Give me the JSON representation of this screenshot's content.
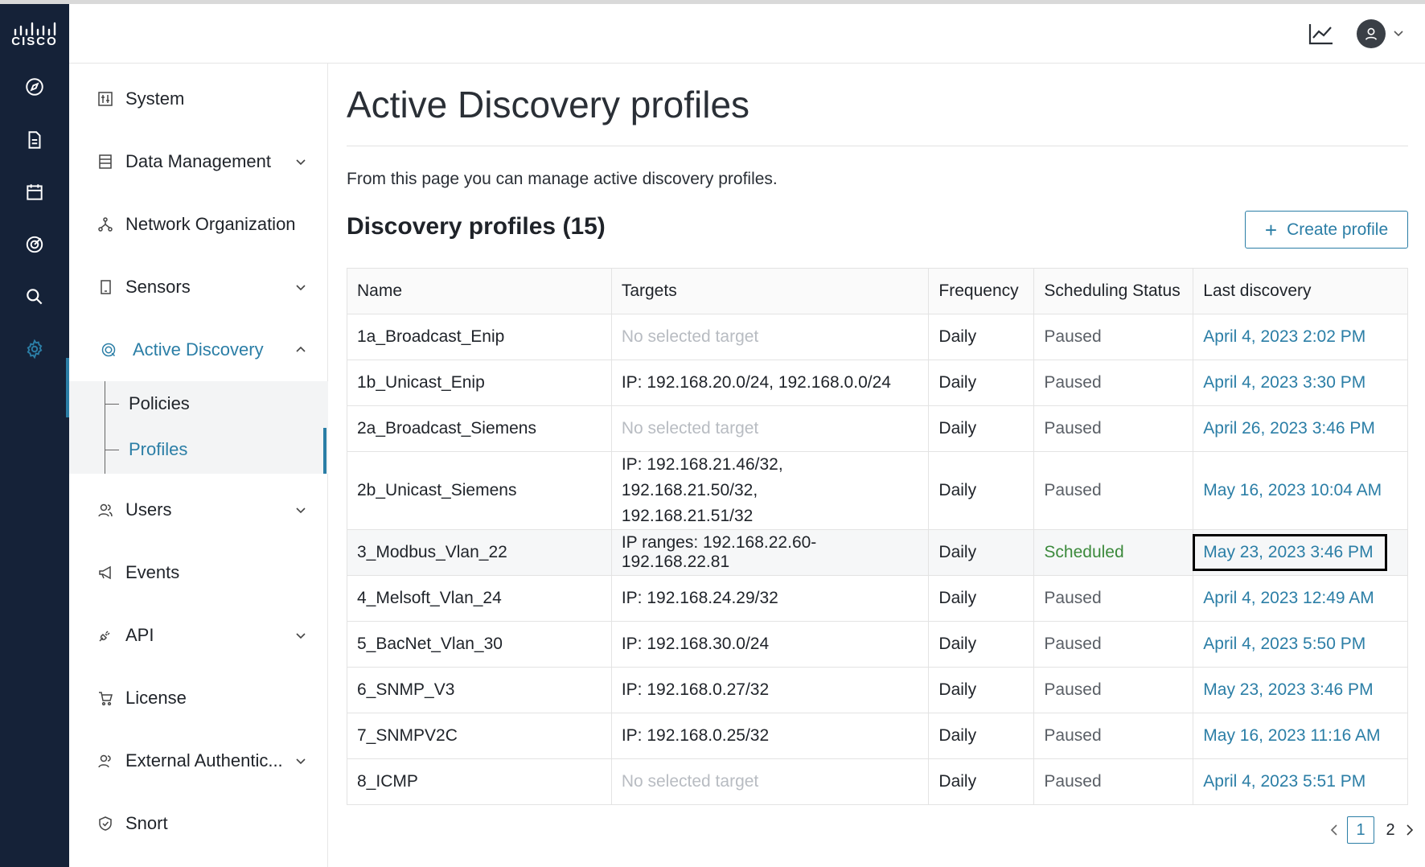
{
  "brand": {
    "logo_text": "CISCO"
  },
  "sidebar": {
    "items": [
      {
        "label": "System"
      },
      {
        "label": "Data Management"
      },
      {
        "label": "Network Organization"
      },
      {
        "label": "Sensors"
      },
      {
        "label": "Active Discovery"
      },
      {
        "label": "Users"
      },
      {
        "label": "Events"
      },
      {
        "label": "API"
      },
      {
        "label": "License"
      },
      {
        "label": "External Authentic..."
      },
      {
        "label": "Snort"
      }
    ],
    "subitems": [
      {
        "label": "Policies"
      },
      {
        "label": "Profiles"
      }
    ]
  },
  "page": {
    "title": "Active Discovery profiles",
    "description": "From this page you can manage active discovery profiles.",
    "section_title": "Discovery profiles (15)",
    "create_label": "Create profile"
  },
  "table": {
    "headers": [
      "Name",
      "Targets",
      "Frequency",
      "Scheduling Status",
      "Last discovery"
    ],
    "rows": [
      {
        "name": "1a_Broadcast_Enip",
        "targets": "No selected target",
        "frequency": "Daily",
        "status": "Paused",
        "last": "April 4, 2023 2:02 PM"
      },
      {
        "name": "1b_Unicast_Enip",
        "targets": "IP: 192.168.20.0/24, 192.168.0.0/24",
        "frequency": "Daily",
        "status": "Paused",
        "last": "April 4, 2023 3:30 PM"
      },
      {
        "name": "2a_Broadcast_Siemens",
        "targets": "No selected target",
        "frequency": "Daily",
        "status": "Paused",
        "last": "April 26, 2023 3:46 PM"
      },
      {
        "name": "2b_Unicast_Siemens",
        "targets_line1": "IP: 192.168.21.46/32, 192.168.21.50/32,",
        "targets_line2": "192.168.21.51/32",
        "frequency": "Daily",
        "status": "Paused",
        "last": "May 16, 2023 10:04 AM"
      },
      {
        "name": "3_Modbus_Vlan_22",
        "targets": "IP ranges: 192.168.22.60-192.168.22.81",
        "frequency": "Daily",
        "status": "Scheduled",
        "last": "May 23, 2023 3:46 PM"
      },
      {
        "name": "4_Melsoft_Vlan_24",
        "targets": "IP: 192.168.24.29/32",
        "frequency": "Daily",
        "status": "Paused",
        "last": "April 4, 2023 12:49 AM"
      },
      {
        "name": "5_BacNet_Vlan_30",
        "targets": "IP: 192.168.30.0/24",
        "frequency": "Daily",
        "status": "Paused",
        "last": "April 4, 2023 5:50 PM"
      },
      {
        "name": "6_SNMP_V3",
        "targets": "IP: 192.168.0.27/32",
        "frequency": "Daily",
        "status": "Paused",
        "last": "May 23, 2023 3:46 PM"
      },
      {
        "name": "7_SNMPV2C",
        "targets": "IP: 192.168.0.25/32",
        "frequency": "Daily",
        "status": "Paused",
        "last": "May 16, 2023 11:16 AM"
      },
      {
        "name": "8_ICMP",
        "targets": "No selected target",
        "frequency": "Daily",
        "status": "Paused",
        "last": "April 4, 2023 5:51 PM"
      }
    ]
  },
  "pagination": {
    "pages": [
      "1",
      "2"
    ],
    "current": "1"
  },
  "colors": {
    "accent": "#2b7ea6",
    "rail": "#152238",
    "scheduled": "#3c8a3c"
  }
}
